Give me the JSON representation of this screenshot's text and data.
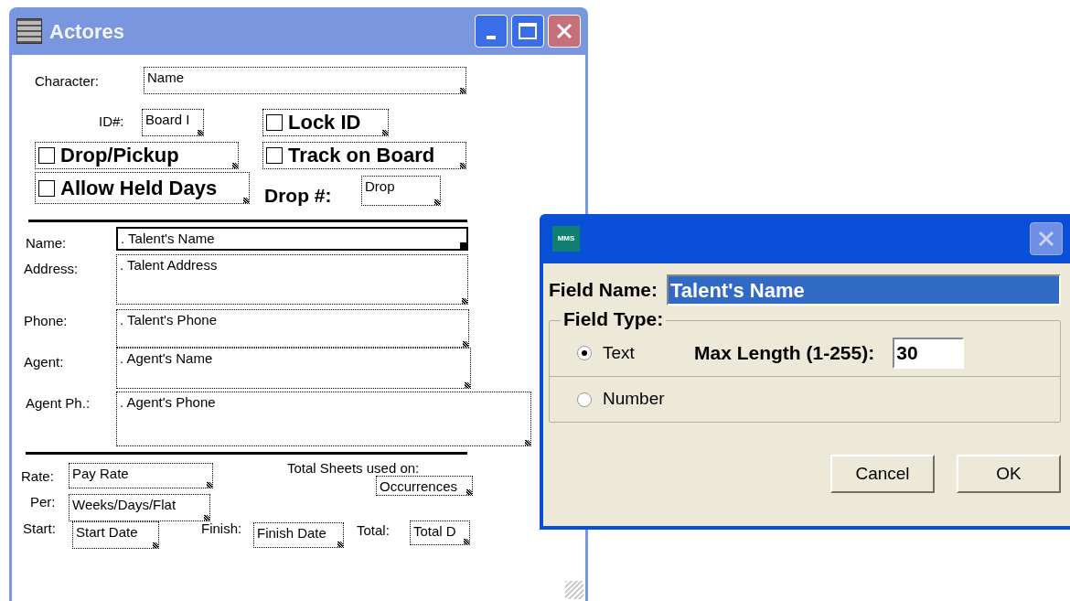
{
  "main_window": {
    "title": "Actores",
    "items": [
      {
        "kind": "label",
        "text": "Character:"
      },
      {
        "kind": "field",
        "text": "Name",
        "selected": false
      },
      {
        "kind": "label",
        "text": "ID#:"
      },
      {
        "kind": "field",
        "text": "Board I",
        "selected": false
      },
      {
        "kind": "checkbox",
        "text": "Lock ID",
        "checked": false
      },
      {
        "kind": "checkbox",
        "text": "Drop/Pickup",
        "checked": false
      },
      {
        "kind": "checkbox",
        "text": "Track on Board",
        "checked": false
      },
      {
        "kind": "checkbox",
        "text": "Allow Held Days",
        "checked": false
      },
      {
        "kind": "bold_label",
        "text": "Drop #:"
      },
      {
        "kind": "field",
        "text": "Drop",
        "selected": false
      },
      {
        "kind": "rule"
      },
      {
        "kind": "label",
        "text": "Name:"
      },
      {
        "kind": "field",
        "text": ". Talent's Name",
        "selected": true
      },
      {
        "kind": "label",
        "text": "Address:"
      },
      {
        "kind": "field",
        "text": ". Talent Address",
        "selected": false
      },
      {
        "kind": "label",
        "text": "Phone:"
      },
      {
        "kind": "field",
        "text": ". Talent's Phone",
        "selected": false
      },
      {
        "kind": "label",
        "text": "Agent:"
      },
      {
        "kind": "field",
        "text": ". Agent's Name",
        "selected": false
      },
      {
        "kind": "label",
        "text": "Agent Ph.:"
      },
      {
        "kind": "field",
        "text": ". Agent's Phone",
        "selected": false
      },
      {
        "kind": "rule"
      },
      {
        "kind": "label",
        "text": "Rate:"
      },
      {
        "kind": "field",
        "text": "Pay Rate",
        "selected": false
      },
      {
        "kind": "label",
        "text": "Total Sheets used on:"
      },
      {
        "kind": "field",
        "text": "Occurrences",
        "selected": false
      },
      {
        "kind": "label",
        "text": "Per:"
      },
      {
        "kind": "field",
        "text": "Weeks/Days/Flat",
        "selected": false
      },
      {
        "kind": "label",
        "text": "Start:"
      },
      {
        "kind": "field",
        "text": "Start Date",
        "selected": false
      },
      {
        "kind": "label",
        "text": "Finish:"
      },
      {
        "kind": "field",
        "text": "Finish Date",
        "selected": false
      },
      {
        "kind": "label",
        "text": "Total:"
      },
      {
        "kind": "field",
        "text": "Total D",
        "selected": false
      }
    ]
  },
  "dialog": {
    "icon_text": "MMS",
    "field_name_label": "Field Name:",
    "field_name_value": "Talent's Name",
    "field_name_highlighted": true,
    "group_title": "Field Type:",
    "options": [
      {
        "label": "Text",
        "selected": true
      },
      {
        "label": "Number",
        "selected": false
      }
    ],
    "max_length_label": "Max Length (1-255):",
    "max_length_value": "30",
    "buttons": [
      "Cancel",
      "OK"
    ]
  }
}
